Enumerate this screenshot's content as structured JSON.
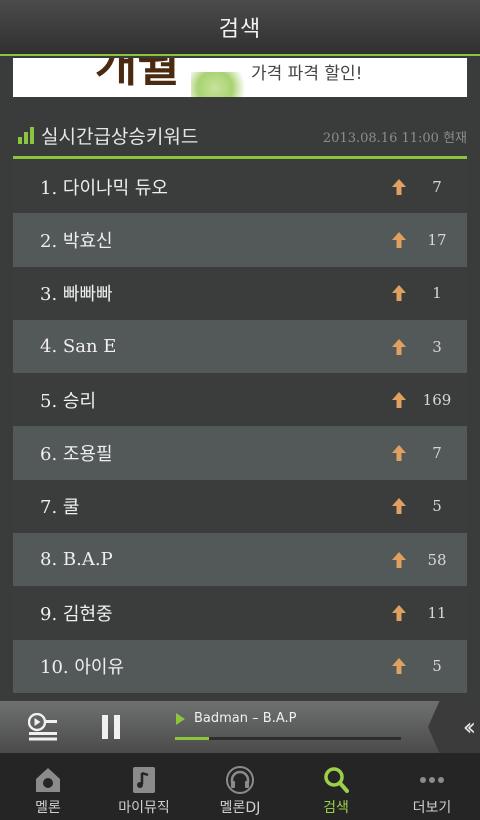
{
  "header": {
    "title": "검색"
  },
  "banner": {
    "big_text": "개월",
    "small_text": "가격 파격 할인!"
  },
  "section": {
    "title": "실시간급상승키워드",
    "timestamp": "2013.08.16 11:00 현재",
    "icon": "bar-chart-icon"
  },
  "keywords": [
    {
      "label": "1. 다이나믹 듀오",
      "count": "7"
    },
    {
      "label": "2. 박효신",
      "count": "17"
    },
    {
      "label": "3. 빠빠빠",
      "count": "1"
    },
    {
      "label": "4. San E",
      "count": "3"
    },
    {
      "label": "5. 승리",
      "count": "169"
    },
    {
      "label": "6. 조용필",
      "count": "7"
    },
    {
      "label": "7. 쿨",
      "count": "5"
    },
    {
      "label": "8. B.A.P",
      "count": "58"
    },
    {
      "label": "9. 김현중",
      "count": "11"
    },
    {
      "label": "10. 아이유",
      "count": "5"
    }
  ],
  "player": {
    "song": "Badman – B.A.P",
    "progress": 0.15
  },
  "nav": [
    {
      "label": "멜론",
      "icon": "home-icon"
    },
    {
      "label": "마이뮤직",
      "icon": "music-note-icon"
    },
    {
      "label": "멜론DJ",
      "icon": "headphones-icon"
    },
    {
      "label": "검색",
      "icon": "search-icon",
      "active": true
    },
    {
      "label": "더보기",
      "icon": "more-icon"
    }
  ],
  "colors": {
    "accent": "#8cc43f",
    "up_arrow": "#e0a060"
  }
}
